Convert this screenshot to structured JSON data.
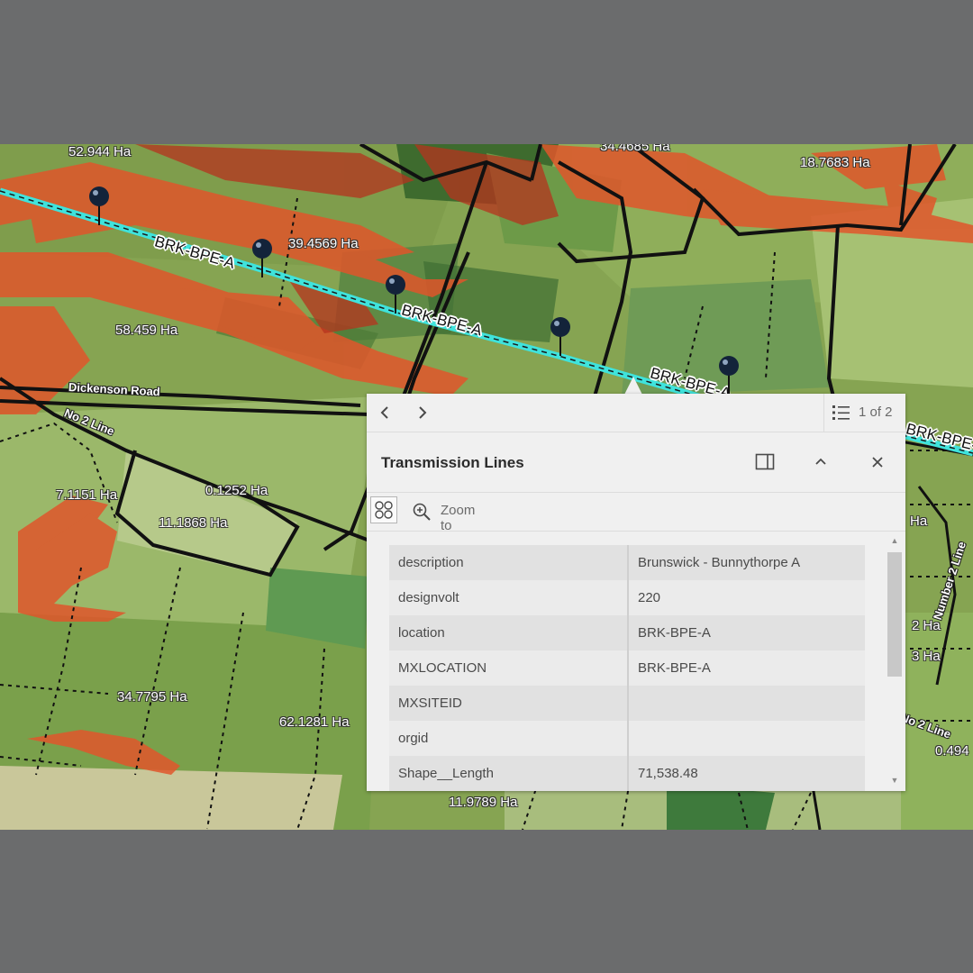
{
  "map": {
    "area_labels": [
      "52.944 Ha",
      "34.4685 Ha",
      "18.7683 Ha",
      "39.4569 Ha",
      "58.459 Ha",
      "7.1151 Ha",
      "0.1252 Ha",
      "11.1868 Ha",
      "34.7795 Ha",
      "62.1281 Ha",
      "11.9789 Ha",
      "Ha",
      "2 Ha",
      "3 Ha",
      "0.494"
    ],
    "line_labels": [
      "BRK-BPE-A",
      "BRK-BPE-A",
      "BRK-BPE-A",
      "BRK-BPE-A"
    ],
    "road_labels": [
      "Dickenson Road",
      "No 2 Line",
      "Number 2 Line",
      "No 2 Line"
    ],
    "colors": {
      "transmission_line": "#3fe3dc",
      "hazard_zone": "#e0562b",
      "parcel_outline": "#111111"
    }
  },
  "popup": {
    "prev_icon": "chevron-left-icon",
    "next_icon": "chevron-right-icon",
    "feature_count": "1 of 2",
    "title": "Transmission Lines",
    "zoom_label": "Zoom to",
    "attributes": [
      {
        "key": "description",
        "value": "Brunswick - Bunnythorpe A"
      },
      {
        "key": "designvolt",
        "value": "220"
      },
      {
        "key": "location",
        "value": "BRK-BPE-A"
      },
      {
        "key": "MXLOCATION",
        "value": "BRK-BPE-A"
      },
      {
        "key": "MXSITEID",
        "value": ""
      },
      {
        "key": "orgid",
        "value": ""
      },
      {
        "key": "Shape__Length",
        "value": "71,538.48"
      }
    ]
  }
}
